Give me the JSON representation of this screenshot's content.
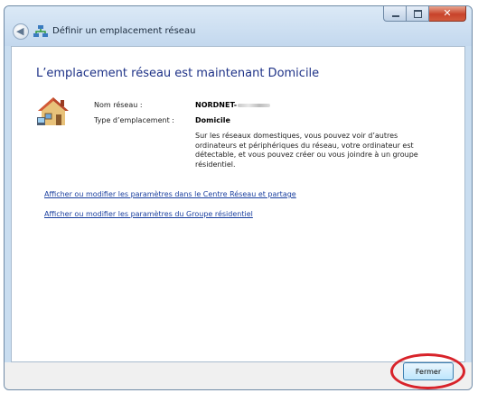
{
  "window": {
    "title": "Définir un emplacement réseau",
    "controls": {
      "close_label": "✕"
    }
  },
  "main": {
    "heading": "L’emplacement réseau est maintenant Domicile",
    "network_name_label": "Nom réseau :",
    "network_name_value": "NORDNET-",
    "location_type_label": "Type d’emplacement :",
    "location_type_value": "Domicile",
    "description": "Sur les réseaux domestiques, vous pouvez voir d’autres ordinateurs et périphériques du réseau, votre ordinateur est détectable, et vous pouvez créer ou vous joindre à un groupe résidentiel.",
    "links": [
      "Afficher ou modifier les paramètres dans le Centre Réseau et partage",
      "Afficher ou modifier les paramètres du Groupe résidentiel"
    ]
  },
  "footer": {
    "close_button": "Fermer"
  },
  "colors": {
    "heading": "#1e3287",
    "link": "#1a3f9f",
    "highlight": "#d8232a"
  },
  "icons": [
    "back-arrow-icon",
    "network-icon",
    "home-network-icon"
  ]
}
